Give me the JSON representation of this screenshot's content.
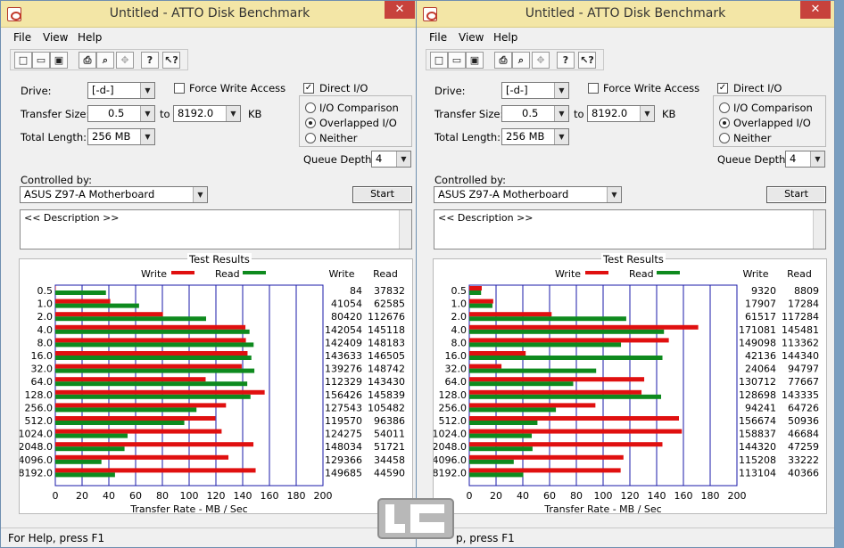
{
  "windows": [
    {
      "title": "Untitled - ATTO Disk Benchmark",
      "close_glyph": "✕",
      "menu": [
        "File",
        "View",
        "Help"
      ],
      "toolbar": {
        "buttons": [
          {
            "icon": "new-icon",
            "glyph": "□"
          },
          {
            "icon": "open-icon",
            "glyph": "▭"
          },
          {
            "icon": "save-icon",
            "glyph": "▣"
          },
          {
            "icon": "print-icon",
            "glyph": "⎙"
          },
          {
            "icon": "print-preview-icon",
            "glyph": "⌕"
          },
          {
            "icon": "move-icon",
            "glyph": "✥"
          },
          {
            "icon": "help-icon",
            "glyph": "?"
          },
          {
            "icon": "context-help-icon",
            "glyph": "↖?"
          }
        ]
      },
      "drive_label": "Drive:",
      "drive_value": "[-d-]",
      "force_write_label": "Force Write Access",
      "direct_io_label": "Direct I/O",
      "transfer_size_label": "Transfer Size:",
      "transfer_from": "0.5",
      "to_label": "to",
      "transfer_to": "8192.0",
      "kb_label": "KB",
      "total_length_label": "Total Length:",
      "total_length_value": "256 MB",
      "io_comparison_label": "I/O Comparison",
      "overlapped_io_label": "Overlapped I/O",
      "neither_label": "Neither",
      "queue_depth_label": "Queue Depth:",
      "queue_depth_value": "4",
      "controlled_by_label": "Controlled by:",
      "controller": "ASUS Z97-A Motherboard",
      "start_label": "Start",
      "description": "<< Description >>",
      "results_title": "Test Results",
      "write_legend": "Write",
      "read_legend": "Read",
      "write_col": "Write",
      "read_col": "Read",
      "status": "For Help, press F1"
    },
    {
      "title": "Untitled - ATTO Disk Benchmark",
      "close_glyph": "✕",
      "menu": [
        "File",
        "View",
        "Help"
      ],
      "toolbar": {
        "buttons": [
          {
            "icon": "new-icon",
            "glyph": "□"
          },
          {
            "icon": "open-icon",
            "glyph": "▭"
          },
          {
            "icon": "save-icon",
            "glyph": "▣"
          },
          {
            "icon": "print-icon",
            "glyph": "⎙"
          },
          {
            "icon": "print-preview-icon",
            "glyph": "⌕"
          },
          {
            "icon": "move-icon",
            "glyph": "✥"
          },
          {
            "icon": "help-icon",
            "glyph": "?"
          },
          {
            "icon": "context-help-icon",
            "glyph": "↖?"
          }
        ]
      },
      "drive_label": "Drive:",
      "drive_value": "[-d-]",
      "force_write_label": "Force Write Access",
      "direct_io_label": "Direct I/O",
      "transfer_size_label": "Transfer Size:",
      "transfer_from": "0.5",
      "to_label": "to",
      "transfer_to": "8192.0",
      "kb_label": "KB",
      "total_length_label": "Total Length:",
      "total_length_value": "256 MB",
      "io_comparison_label": "I/O Comparison",
      "overlapped_io_label": "Overlapped I/O",
      "neither_label": "Neither",
      "queue_depth_label": "Queue Depth:",
      "queue_depth_value": "4",
      "controlled_by_label": "Controlled by:",
      "controller": "ASUS Z97-A Motherboard",
      "start_label": "Start",
      "description": "<< Description >>",
      "results_title": "Test Results",
      "write_legend": "Write",
      "read_legend": "Read",
      "write_col": "Write",
      "read_col": "Read",
      "status": "p, press F1"
    }
  ],
  "colors": {
    "write": "#e01010",
    "read": "#0e8a1e"
  },
  "chart_data": [
    {
      "type": "bar",
      "orientation": "horizontal",
      "xlabel": "Transfer Rate - MB / Sec",
      "xlim": [
        0,
        200
      ],
      "xticks": [
        "0",
        "20",
        "40",
        "60",
        "80",
        "100",
        "120",
        "140",
        "160",
        "180",
        "200"
      ],
      "categories": [
        "0.5",
        "1.0",
        "2.0",
        "4.0",
        "8.0",
        "16.0",
        "32.0",
        "64.0",
        "128.0",
        "256.0",
        "512.0",
        "1024.0",
        "2048.0",
        "4096.0",
        "8192.0"
      ],
      "series": [
        {
          "name": "Write",
          "values": [
            0.084,
            41.054,
            80.42,
            142.054,
            142.409,
            143.633,
            139.276,
            112.329,
            156.426,
            127.543,
            119.57,
            124.275,
            148.034,
            129.366,
            149.685
          ]
        },
        {
          "name": "Read",
          "values": [
            37.832,
            62.585,
            112.676,
            145.118,
            148.183,
            146.505,
            148.742,
            143.43,
            145.839,
            105.482,
            96.386,
            54.011,
            51.721,
            34.458,
            44.59
          ]
        }
      ],
      "write_labels": [
        "84",
        "41054",
        "80420",
        "142054",
        "142409",
        "143633",
        "139276",
        "112329",
        "156426",
        "127543",
        "119570",
        "124275",
        "148034",
        "129366",
        "149685"
      ],
      "read_labels": [
        "37832",
        "62585",
        "112676",
        "145118",
        "148183",
        "146505",
        "148742",
        "143430",
        "145839",
        "105482",
        "96386",
        "54011",
        "51721",
        "34458",
        "44590"
      ]
    },
    {
      "type": "bar",
      "orientation": "horizontal",
      "xlabel": "Transfer Rate - MB / Sec",
      "xlim": [
        0,
        200
      ],
      "xticks": [
        "0",
        "20",
        "40",
        "60",
        "80",
        "100",
        "120",
        "140",
        "160",
        "180",
        "200"
      ],
      "categories": [
        "0.5",
        "1.0",
        "2.0",
        "4.0",
        "8.0",
        "16.0",
        "32.0",
        "64.0",
        "128.0",
        "256.0",
        "512.0",
        "1024.0",
        "2048.0",
        "4096.0",
        "8192.0"
      ],
      "series": [
        {
          "name": "Write",
          "values": [
            9.32,
            17.907,
            61.517,
            171.081,
            149.098,
            42.136,
            24.064,
            130.712,
            128.698,
            94.241,
            156.674,
            158.837,
            144.32,
            115.208,
            113.104
          ]
        },
        {
          "name": "Read",
          "values": [
            8.809,
            17.284,
            117.284,
            145.481,
            113.362,
            144.34,
            94.797,
            77.667,
            143.335,
            64.726,
            50.936,
            46.684,
            47.259,
            33.222,
            40.366
          ]
        }
      ],
      "write_labels": [
        "9320",
        "17907",
        "61517",
        "171081",
        "149098",
        "42136",
        "24064",
        "130712",
        "128698",
        "94241",
        "156674",
        "158837",
        "144320",
        "115208",
        "113104"
      ],
      "read_labels": [
        "8809",
        "17284",
        "117284",
        "145481",
        "113362",
        "144340",
        "94797",
        "77667",
        "143335",
        "64726",
        "50936",
        "46684",
        "47259",
        "33222",
        "40366"
      ]
    }
  ]
}
